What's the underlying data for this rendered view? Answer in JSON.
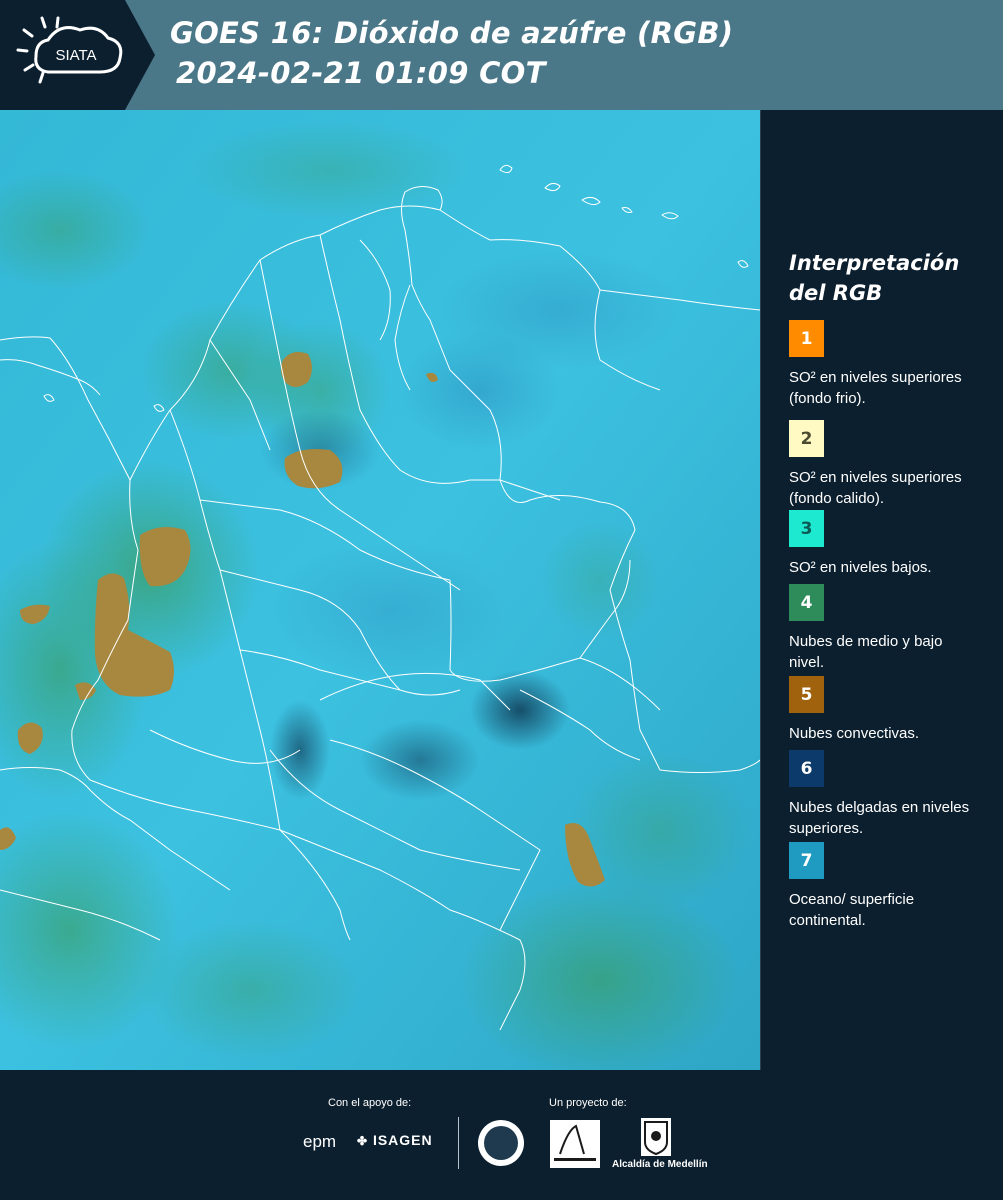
{
  "header": {
    "logo_text": "SIATA",
    "title_line1": "GOES 16: Dióxido de azúfre (RGB)",
    "title_line2": "2024-02-21 01:09 COT"
  },
  "legend": {
    "title_line1": "Interpretación",
    "title_line2": "del RGB",
    "items": [
      {
        "number": "1",
        "color": "#ff8c00",
        "text": "SO² en niveles superiores (fondo frio)."
      },
      {
        "number": "2",
        "color": "#fff9c4",
        "text": "SO² en niveles superiores (fondo calido)."
      },
      {
        "number": "3",
        "color": "#1de9d0",
        "text": "SO² en niveles bajos."
      },
      {
        "number": "4",
        "color": "#2e8b5a",
        "text": "Nubes de medio y bajo nivel."
      },
      {
        "number": "5",
        "color": "#a0620c",
        "text": "Nubes convectivas."
      },
      {
        "number": "6",
        "color": "#0b3a6b",
        "text": "Nubes delgadas en niveles superiores."
      },
      {
        "number": "7",
        "color": "#1f9bc2",
        "text": "Oceano/ superficie continental."
      }
    ]
  },
  "footer": {
    "support_label": "Con el apoyo de:",
    "project_label": "Un proyecto de:",
    "sponsor_epm": "epm",
    "sponsor_isagen": "ISAGEN",
    "alcaldia_text": "Alcaldía de Medellín"
  },
  "colors": {
    "header_bg": "#4b7889",
    "panel_bg": "#0c1f2e",
    "map_base": "#2fb5d8"
  }
}
